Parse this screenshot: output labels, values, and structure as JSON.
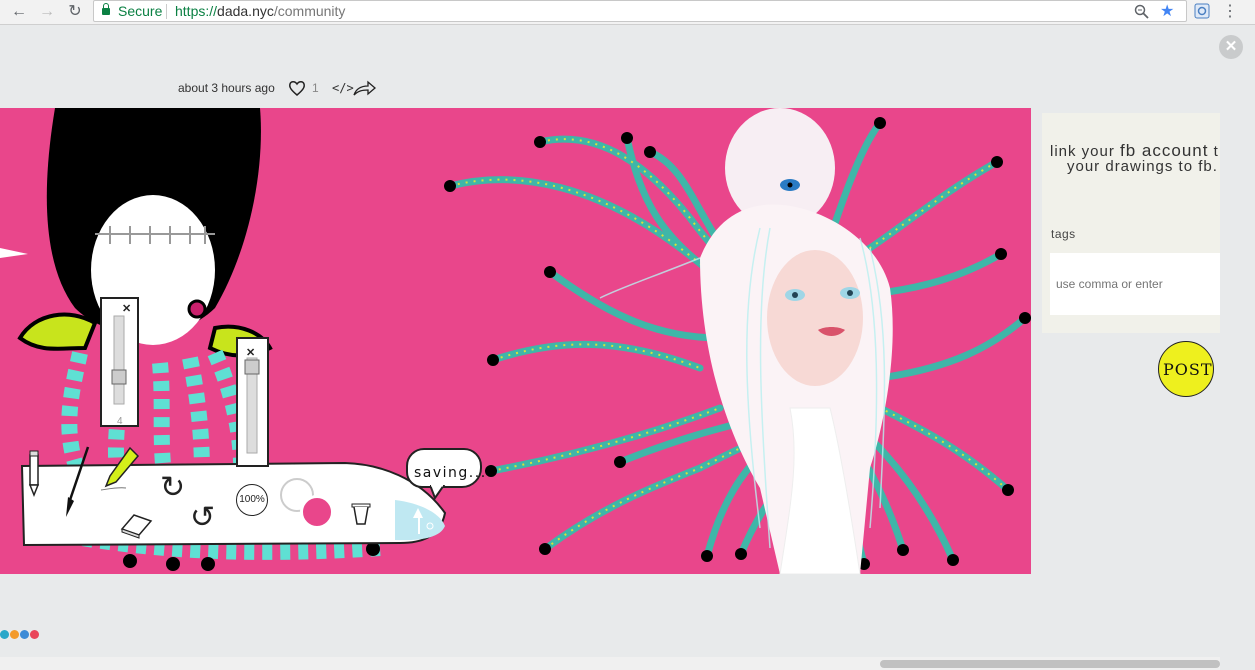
{
  "browser": {
    "secure_label": "Secure",
    "url_scheme": "https://",
    "url_host": "dada.nyc",
    "url_path": "/community",
    "back_icon": "←",
    "forward_icon": "→",
    "reload_icon": "↻",
    "zoom_icon": "search-icon",
    "star_icon": "★",
    "menu_icon": "⋮"
  },
  "post": {
    "timestamp": "about 3 hours ago",
    "like_count": "1",
    "embed_icon": "</>",
    "share_icon": "share-icon"
  },
  "close_icon": "✕",
  "side_panel": {
    "fb_text_line1_a": "link your ",
    "fb_text_line1_b": "fb account",
    "fb_text_line1_c": " t",
    "fb_text_line2": "your drawings to fb.",
    "tags_label": "tags",
    "tags_placeholder": "use comma or enter",
    "post_label": "POST"
  },
  "toolbar": {
    "brush_size_value": "4",
    "zoom_label": "100%",
    "saving_label": "saving..."
  },
  "colors": {
    "canvas_bg": "#e9468b",
    "post_button": "#eef01e",
    "secondary_color": "#ffffff",
    "primary_color": "#e9468b",
    "dots": [
      "#2aa7c9",
      "#f39a2b",
      "#3c8bd6",
      "#e9465a"
    ]
  }
}
